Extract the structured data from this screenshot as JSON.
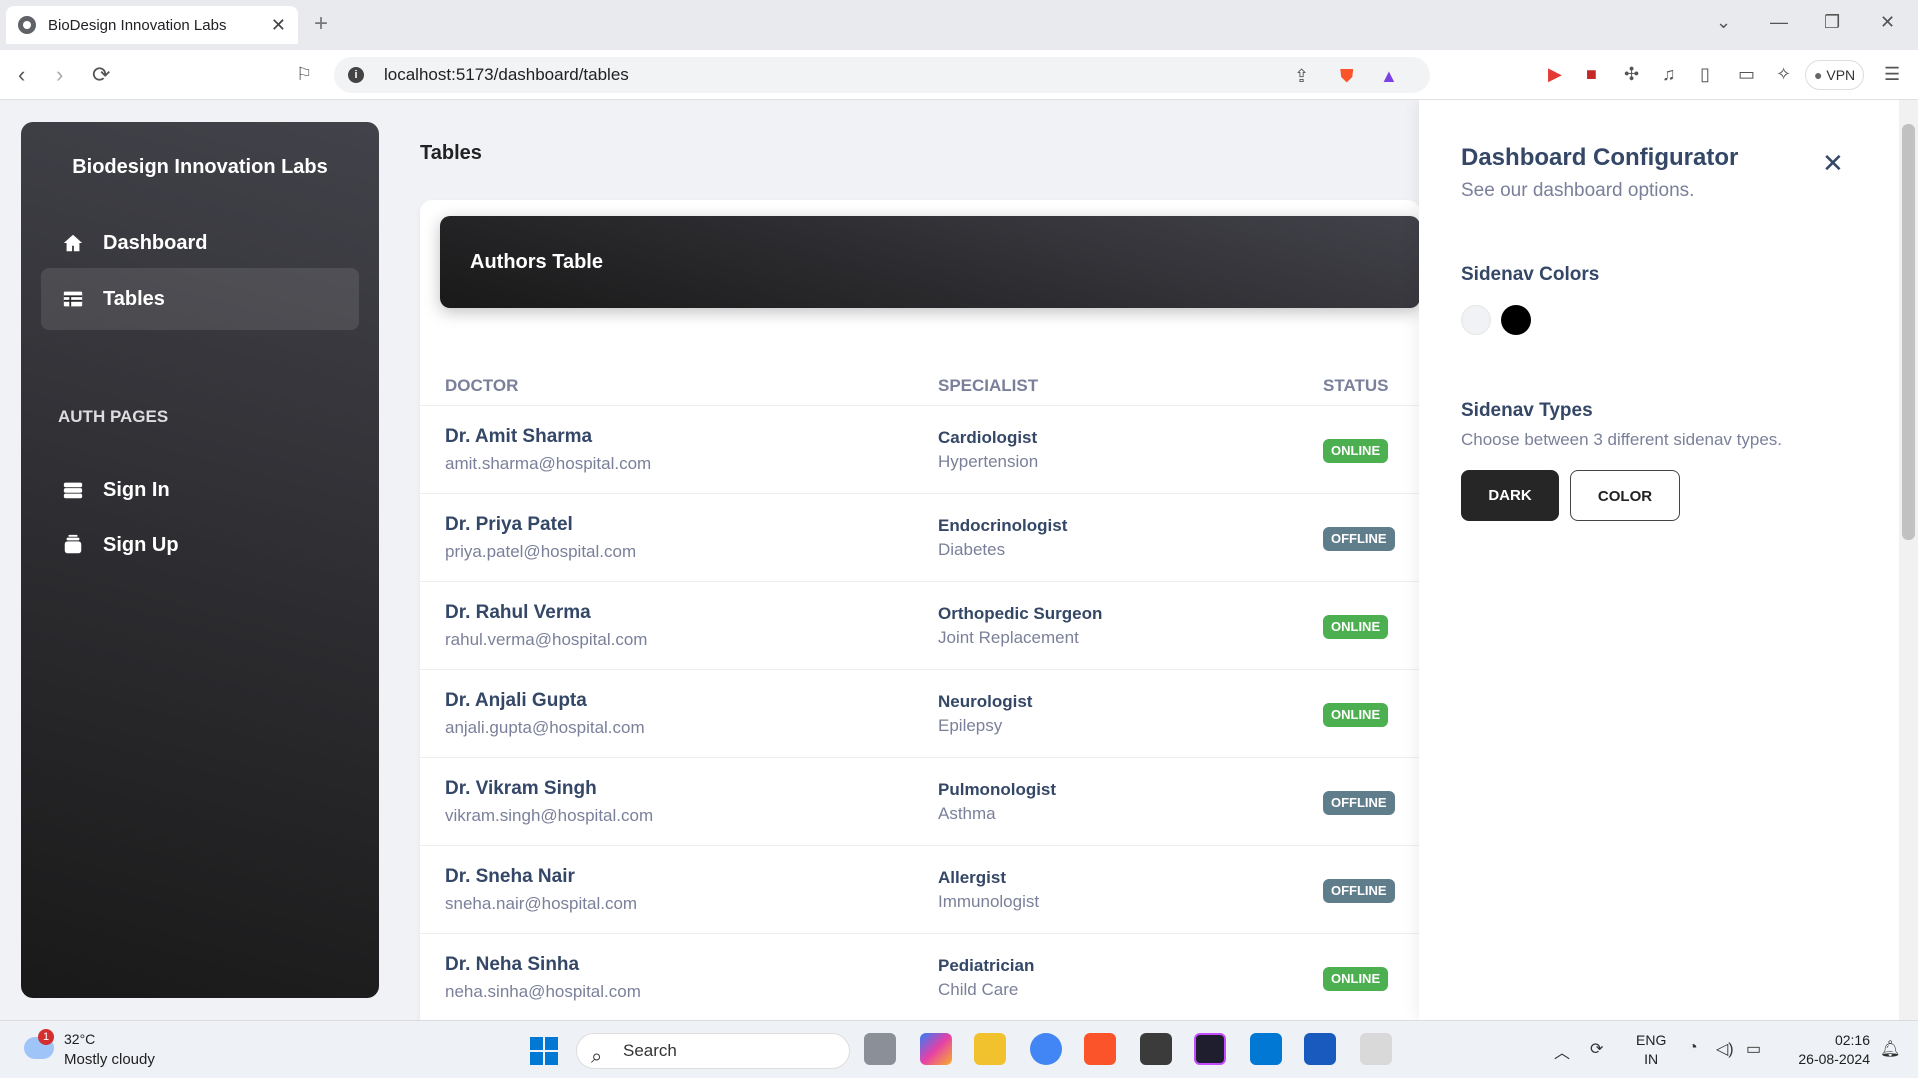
{
  "browser": {
    "tab_title": "BioDesign Innovation Labs",
    "url": "localhost:5173/dashboard/tables",
    "vpn_label": "VPN"
  },
  "sidenav": {
    "brand": "Biodesign Innovation Labs",
    "items": [
      {
        "label": "Dashboard",
        "icon": "home-icon"
      },
      {
        "label": "Tables",
        "icon": "table-icon"
      }
    ],
    "section_label": "AUTH PAGES",
    "auth_items": [
      {
        "label": "Sign In",
        "icon": "login-icon"
      },
      {
        "label": "Sign Up",
        "icon": "assignment-icon"
      }
    ]
  },
  "page": {
    "title": "Tables"
  },
  "table": {
    "title": "Authors Table",
    "columns": [
      "DOCTOR",
      "SPECIALIST",
      "STATUS"
    ],
    "rows": [
      {
        "name": "Dr. Amit Sharma",
        "email": "amit.sharma@hospital.com",
        "specialty": "Cardiologist",
        "sub": "Hypertension",
        "status": "ONLINE"
      },
      {
        "name": "Dr. Priya Patel",
        "email": "priya.patel@hospital.com",
        "specialty": "Endocrinologist",
        "sub": "Diabetes",
        "status": "OFFLINE"
      },
      {
        "name": "Dr. Rahul Verma",
        "email": "rahul.verma@hospital.com",
        "specialty": "Orthopedic Surgeon",
        "sub": "Joint Replacement",
        "status": "ONLINE"
      },
      {
        "name": "Dr. Anjali Gupta",
        "email": "anjali.gupta@hospital.com",
        "specialty": "Neurologist",
        "sub": "Epilepsy",
        "status": "ONLINE"
      },
      {
        "name": "Dr. Vikram Singh",
        "email": "vikram.singh@hospital.com",
        "specialty": "Pulmonologist",
        "sub": "Asthma",
        "status": "OFFLINE"
      },
      {
        "name": "Dr. Sneha Nair",
        "email": "sneha.nair@hospital.com",
        "specialty": "Allergist",
        "sub": "Immunologist",
        "status": "OFFLINE"
      },
      {
        "name": "Dr. Neha Sinha",
        "email": "neha.sinha@hospital.com",
        "specialty": "Pediatrician",
        "sub": "Child Care",
        "status": "ONLINE"
      }
    ],
    "status_colors": {
      "ONLINE": "#4caf50",
      "OFFLINE": "#607d8b"
    }
  },
  "configurator": {
    "title": "Dashboard Configurator",
    "subtitle": "See our dashboard options.",
    "colors_heading": "Sidenav Colors",
    "swatches": [
      "#f0f2f5",
      "#000000"
    ],
    "types_heading": "Sidenav Types",
    "types_desc": "Choose between 3 different sidenav types.",
    "btn_dark": "DARK",
    "btn_color": "COLOR"
  },
  "taskbar": {
    "weather_badge": "1",
    "temperature": "32°C",
    "condition": "Mostly cloudy",
    "search_label": "Search",
    "lang_line1": "ENG",
    "lang_line2": "IN",
    "time": "02:16",
    "date": "26-08-2024"
  }
}
